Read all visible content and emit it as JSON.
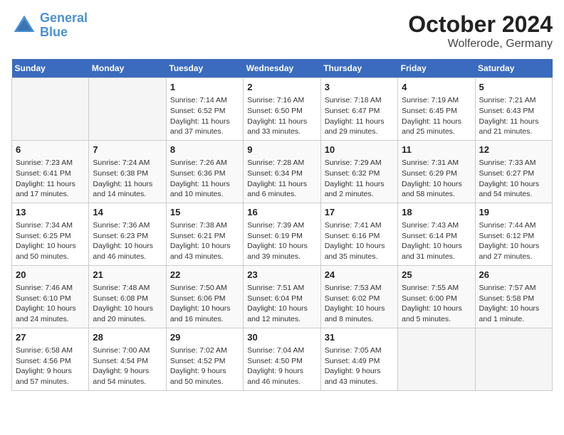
{
  "header": {
    "logo_line1": "General",
    "logo_line2": "Blue",
    "month": "October 2024",
    "location": "Wolferode, Germany"
  },
  "weekdays": [
    "Sunday",
    "Monday",
    "Tuesday",
    "Wednesday",
    "Thursday",
    "Friday",
    "Saturday"
  ],
  "weeks": [
    [
      {
        "day": "",
        "info": ""
      },
      {
        "day": "",
        "info": ""
      },
      {
        "day": "1",
        "info": "Sunrise: 7:14 AM\nSunset: 6:52 PM\nDaylight: 11 hours and 37 minutes."
      },
      {
        "day": "2",
        "info": "Sunrise: 7:16 AM\nSunset: 6:50 PM\nDaylight: 11 hours and 33 minutes."
      },
      {
        "day": "3",
        "info": "Sunrise: 7:18 AM\nSunset: 6:47 PM\nDaylight: 11 hours and 29 minutes."
      },
      {
        "day": "4",
        "info": "Sunrise: 7:19 AM\nSunset: 6:45 PM\nDaylight: 11 hours and 25 minutes."
      },
      {
        "day": "5",
        "info": "Sunrise: 7:21 AM\nSunset: 6:43 PM\nDaylight: 11 hours and 21 minutes."
      }
    ],
    [
      {
        "day": "6",
        "info": "Sunrise: 7:23 AM\nSunset: 6:41 PM\nDaylight: 11 hours and 17 minutes."
      },
      {
        "day": "7",
        "info": "Sunrise: 7:24 AM\nSunset: 6:38 PM\nDaylight: 11 hours and 14 minutes."
      },
      {
        "day": "8",
        "info": "Sunrise: 7:26 AM\nSunset: 6:36 PM\nDaylight: 11 hours and 10 minutes."
      },
      {
        "day": "9",
        "info": "Sunrise: 7:28 AM\nSunset: 6:34 PM\nDaylight: 11 hours and 6 minutes."
      },
      {
        "day": "10",
        "info": "Sunrise: 7:29 AM\nSunset: 6:32 PM\nDaylight: 11 hours and 2 minutes."
      },
      {
        "day": "11",
        "info": "Sunrise: 7:31 AM\nSunset: 6:29 PM\nDaylight: 10 hours and 58 minutes."
      },
      {
        "day": "12",
        "info": "Sunrise: 7:33 AM\nSunset: 6:27 PM\nDaylight: 10 hours and 54 minutes."
      }
    ],
    [
      {
        "day": "13",
        "info": "Sunrise: 7:34 AM\nSunset: 6:25 PM\nDaylight: 10 hours and 50 minutes."
      },
      {
        "day": "14",
        "info": "Sunrise: 7:36 AM\nSunset: 6:23 PM\nDaylight: 10 hours and 46 minutes."
      },
      {
        "day": "15",
        "info": "Sunrise: 7:38 AM\nSunset: 6:21 PM\nDaylight: 10 hours and 43 minutes."
      },
      {
        "day": "16",
        "info": "Sunrise: 7:39 AM\nSunset: 6:19 PM\nDaylight: 10 hours and 39 minutes."
      },
      {
        "day": "17",
        "info": "Sunrise: 7:41 AM\nSunset: 6:16 PM\nDaylight: 10 hours and 35 minutes."
      },
      {
        "day": "18",
        "info": "Sunrise: 7:43 AM\nSunset: 6:14 PM\nDaylight: 10 hours and 31 minutes."
      },
      {
        "day": "19",
        "info": "Sunrise: 7:44 AM\nSunset: 6:12 PM\nDaylight: 10 hours and 27 minutes."
      }
    ],
    [
      {
        "day": "20",
        "info": "Sunrise: 7:46 AM\nSunset: 6:10 PM\nDaylight: 10 hours and 24 minutes."
      },
      {
        "day": "21",
        "info": "Sunrise: 7:48 AM\nSunset: 6:08 PM\nDaylight: 10 hours and 20 minutes."
      },
      {
        "day": "22",
        "info": "Sunrise: 7:50 AM\nSunset: 6:06 PM\nDaylight: 10 hours and 16 minutes."
      },
      {
        "day": "23",
        "info": "Sunrise: 7:51 AM\nSunset: 6:04 PM\nDaylight: 10 hours and 12 minutes."
      },
      {
        "day": "24",
        "info": "Sunrise: 7:53 AM\nSunset: 6:02 PM\nDaylight: 10 hours and 8 minutes."
      },
      {
        "day": "25",
        "info": "Sunrise: 7:55 AM\nSunset: 6:00 PM\nDaylight: 10 hours and 5 minutes."
      },
      {
        "day": "26",
        "info": "Sunrise: 7:57 AM\nSunset: 5:58 PM\nDaylight: 10 hours and 1 minute."
      }
    ],
    [
      {
        "day": "27",
        "info": "Sunrise: 6:58 AM\nSunset: 4:56 PM\nDaylight: 9 hours and 57 minutes."
      },
      {
        "day": "28",
        "info": "Sunrise: 7:00 AM\nSunset: 4:54 PM\nDaylight: 9 hours and 54 minutes."
      },
      {
        "day": "29",
        "info": "Sunrise: 7:02 AM\nSunset: 4:52 PM\nDaylight: 9 hours and 50 minutes."
      },
      {
        "day": "30",
        "info": "Sunrise: 7:04 AM\nSunset: 4:50 PM\nDaylight: 9 hours and 46 minutes."
      },
      {
        "day": "31",
        "info": "Sunrise: 7:05 AM\nSunset: 4:49 PM\nDaylight: 9 hours and 43 minutes."
      },
      {
        "day": "",
        "info": ""
      },
      {
        "day": "",
        "info": ""
      }
    ]
  ]
}
